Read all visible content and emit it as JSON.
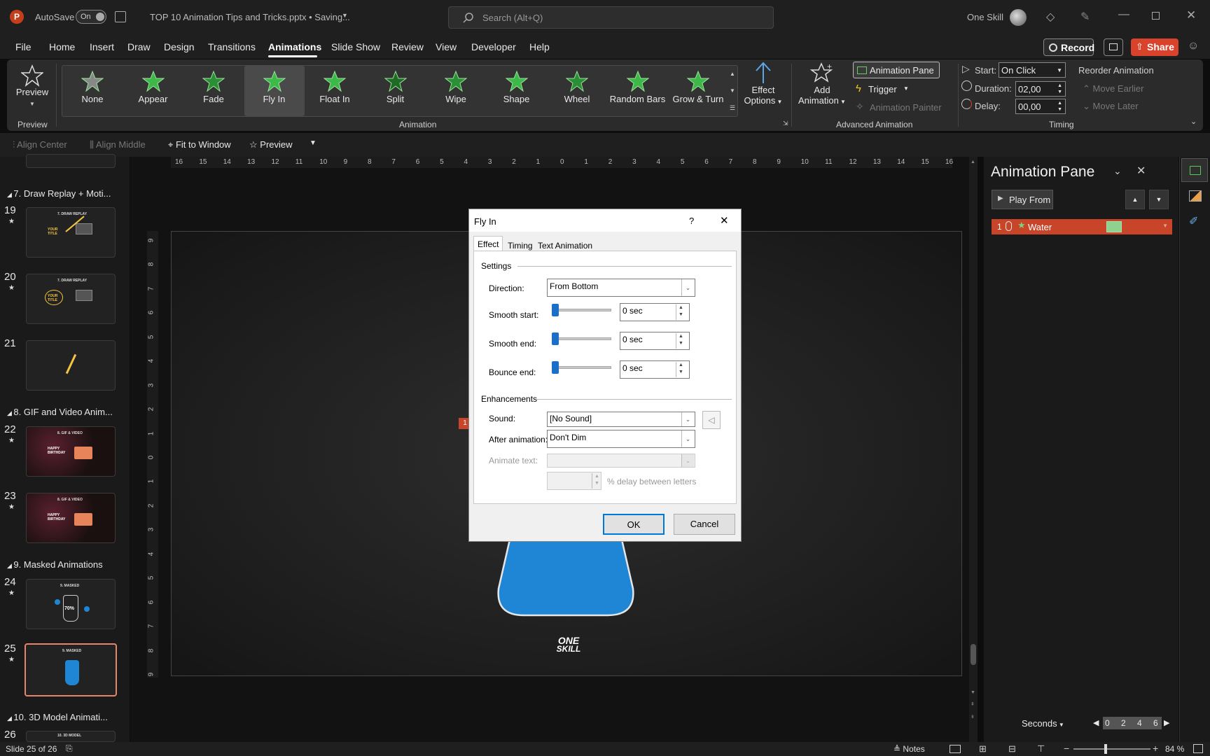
{
  "titlebar": {
    "autosave_label": "AutoSave",
    "autosave_state": "On",
    "document_title": "TOP 10 Animation Tips and Tricks.pptx • Saving...",
    "search_placeholder": "Search (Alt+Q)",
    "user_name": "One Skill"
  },
  "menu": {
    "tabs": [
      "File",
      "Home",
      "Insert",
      "Draw",
      "Design",
      "Transitions",
      "Animations",
      "Slide Show",
      "Review",
      "View",
      "Developer",
      "Help"
    ],
    "active": "Animations",
    "record_label": "Record",
    "share_label": "Share"
  },
  "ribbon": {
    "preview_button": "Preview",
    "preview_group": "Preview",
    "gallery": [
      "None",
      "Appear",
      "Fade",
      "Fly In",
      "Float In",
      "Split",
      "Wipe",
      "Shape",
      "Wheel",
      "Random Bars",
      "Grow & Turn"
    ],
    "gallery_selected": "Fly In",
    "effect_options_line1": "Effect",
    "effect_options_line2": "Options",
    "animation_group": "Animation",
    "add_animation_line1": "Add",
    "add_animation_line2": "Animation",
    "animation_pane_button": "Animation Pane",
    "trigger_button": "Trigger",
    "animation_painter": "Animation Painter",
    "advanced_group": "Advanced Animation",
    "start_label": "Start:",
    "start_value": "On Click",
    "duration_label": "Duration:",
    "duration_value": "02,00",
    "delay_label": "Delay:",
    "delay_value": "00,00",
    "timing_group": "Timing",
    "reorder_label": "Reorder Animation",
    "move_earlier": "Move Earlier",
    "move_later": "Move Later"
  },
  "qat": {
    "align_center": "Align Center",
    "align_middle": "Align Middle",
    "fit_window": "Fit to Window",
    "preview": "Preview"
  },
  "thumbnails": {
    "sections": [
      {
        "label": "7. Draw Replay + Moti..."
      },
      {
        "label": "8. GIF and Video Anim..."
      },
      {
        "label": "9. Masked Animations"
      },
      {
        "label": "10. 3D Model Animati..."
      }
    ],
    "slides": [
      {
        "num": "19",
        "title": "7. DRAW REPLAY"
      },
      {
        "num": "20",
        "title": "7. DRAW REPLAY"
      },
      {
        "num": "21",
        "title": ""
      },
      {
        "num": "22",
        "title": "8. GIF & VIDEO"
      },
      {
        "num": "23",
        "title": "8. GIF & VIDEO"
      },
      {
        "num": "24",
        "title": "9. MASKED"
      },
      {
        "num": "25",
        "title": "9. MASKED"
      },
      {
        "num": "26",
        "title": "10. 3D MODEL"
      }
    ],
    "thumb_text_your_title": "YOUR TITLE",
    "thumb_text_birthday": "HAPPY BIRTHDAY",
    "thumb_text_percent": "70%"
  },
  "ruler": {
    "h_ticks": [
      "16",
      "15",
      "14",
      "13",
      "12",
      "11",
      "10",
      "9",
      "8",
      "7",
      "6",
      "5",
      "4",
      "3",
      "2",
      "1",
      "0",
      "1",
      "2",
      "3",
      "4",
      "5",
      "6",
      "7",
      "8",
      "9",
      "10",
      "11",
      "12",
      "13",
      "14",
      "15",
      "16"
    ],
    "v_ticks": [
      "9",
      "8",
      "7",
      "6",
      "5",
      "4",
      "3",
      "2",
      "1",
      "0",
      "1",
      "2",
      "3",
      "4",
      "5",
      "6",
      "7",
      "8",
      "9"
    ]
  },
  "slide": {
    "tag_number": "1",
    "logo_line1": "ONE",
    "logo_line2": "SKILL"
  },
  "dialog": {
    "title": "Fly In",
    "help": "?",
    "tabs": [
      "Effect",
      "Timing",
      "Text Animation"
    ],
    "active_tab": "Effect",
    "settings_heading": "Settings",
    "direction_label": "Direction:",
    "direction_value": "From Bottom",
    "smooth_start_label": "Smooth start:",
    "smooth_start_value": "0 sec",
    "smooth_end_label": "Smooth end:",
    "smooth_end_value": "0 sec",
    "bounce_end_label": "Bounce end:",
    "bounce_end_value": "0 sec",
    "enhancements_heading": "Enhancements",
    "sound_label": "Sound:",
    "sound_value": "[No Sound]",
    "after_label": "After animation:",
    "after_value": "Don't Dim",
    "animate_text_label": "Animate text:",
    "delay_letters_label": "% delay between letters",
    "ok": "OK",
    "cancel": "Cancel"
  },
  "anipane": {
    "title": "Animation Pane",
    "play_from": "Play From",
    "item_number": "1",
    "item_name": "Water",
    "seconds_label": "Seconds",
    "timeline_ticks": [
      "0",
      "2",
      "4",
      "6"
    ]
  },
  "status": {
    "slide_info": "Slide 25 of 26",
    "notes": "Notes",
    "zoom": "84 %"
  },
  "colors": {
    "accent_red": "#c43e1c",
    "item_bar": "#c8452a",
    "flask_blue": "#1f86d6",
    "slider_blue": "#1c6fc7"
  }
}
